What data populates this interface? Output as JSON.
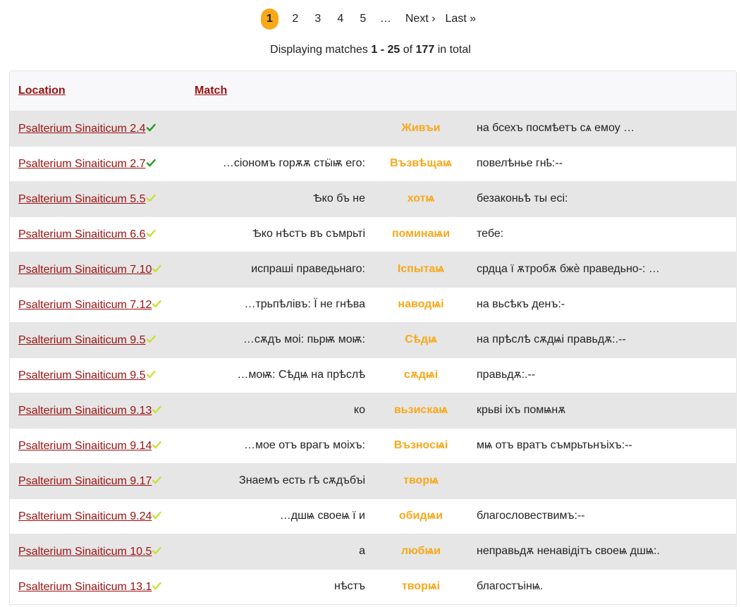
{
  "pagination": {
    "pages": [
      "1",
      "2",
      "3",
      "4",
      "5"
    ],
    "current": "1",
    "ellipsis": "…",
    "next_label": "Next ›",
    "last_label": "Last »",
    "active_color": "#f9a81a"
  },
  "summary": {
    "prefix": "Displaying matches",
    "range": "1 - 25",
    "of": "of",
    "total": "177",
    "suffix": "in total"
  },
  "table": {
    "headers": {
      "location": "Location",
      "match": "Match"
    },
    "link_color": "#9b1010",
    "keyword_color": "#f9a81a",
    "rows": [
      {
        "location": "Psalterium Sinaiticum 2.4",
        "check": "dark-green-check-icon",
        "pre": "",
        "kw": "Живъи",
        "post": "на бсехъ посмѣетъ сѧ емоу …"
      },
      {
        "location": "Psalterium Sinaiticum 2.7",
        "check": "dark-green-check-icon",
        "pre": "…сіономъ горѫѫ стӹѭ его:",
        "kw": "Възвѣщаѩ",
        "post": "повелѣнье гнҍ:--"
      },
      {
        "location": "Psalterium Sinaiticum 5.5",
        "check": "yellow-green-check-icon",
        "pre": "Ѣко бъ не",
        "kw": "хотѩ",
        "post": "безаконьѣ ты есі:"
      },
      {
        "location": "Psalterium Sinaiticum 6.6",
        "check": "yellow-green-check-icon",
        "pre": "Ѣко нѣстъ въ съмрьті",
        "kw": "поминаѩи",
        "post": "тебе:"
      },
      {
        "location": "Psalterium Sinaiticum 7.10",
        "check": "yellow-green-check-icon",
        "pre": "испраші праведьнаго:",
        "kw": "Ӏспытаѩ",
        "post": "срдца ї ѫтробѫ бжѐ праведьно-: …"
      },
      {
        "location": "Psalterium Sinaiticum 7.12",
        "check": "yellow-green-check-icon",
        "pre": "…трьпѣлівъ: Ї не гнѣва",
        "kw": "наводѩі",
        "post": "на вьсѣкъ денъ:-"
      },
      {
        "location": "Psalterium Sinaiticum 9.5",
        "check": "yellow-green-check-icon",
        "pre": "…сѫдъ моі: пьрѭ моѭ:",
        "kw": "Сѣдѩ",
        "post": "на прѣслѣ сѫдѩі правьдѫ:.--"
      },
      {
        "location": "Psalterium Sinaiticum 9.5",
        "check": "yellow-green-check-icon",
        "pre": "…моѭ: Сѣдѩ на прѣслѣ",
        "kw": "сѫдѩі",
        "post": "правьдѫ:.--"
      },
      {
        "location": "Psalterium Sinaiticum 9.13",
        "check": "yellow-green-check-icon",
        "pre": "ко",
        "kw": "вьзискаѩ",
        "post": "крьві іхъ помѩнѫ"
      },
      {
        "location": "Psalterium Sinaiticum 9.14",
        "check": "yellow-green-check-icon",
        "pre": "…мое отъ врагъ моіхъ:",
        "kw": "Възносѩі",
        "post": "мѩ отъ вратъ съмрьтьнъіхъ:--"
      },
      {
        "location": "Psalterium Sinaiticum 9.17",
        "check": "yellow-green-check-icon",
        "pre": "Знаемъ есть гѣ сѫдъбъі",
        "kw": "творѩ",
        "post": ""
      },
      {
        "location": "Psalterium Sinaiticum 9.24",
        "check": "yellow-green-check-icon",
        "pre": "…дшѩ своеѩ ї и",
        "kw": "обидѩи",
        "post": "благословествимъ:--"
      },
      {
        "location": "Psalterium Sinaiticum 10.5",
        "check": "yellow-green-check-icon",
        "pre": "а",
        "kw": "любѩи",
        "post": "неправьдѫ ненавідітъ своеѩ дшѩ:."
      },
      {
        "location": "Psalterium Sinaiticum 13.1",
        "check": "yellow-green-check-icon",
        "pre": "нѣстъ",
        "kw": "творѩі",
        "post": "благостъінѩ."
      }
    ]
  }
}
